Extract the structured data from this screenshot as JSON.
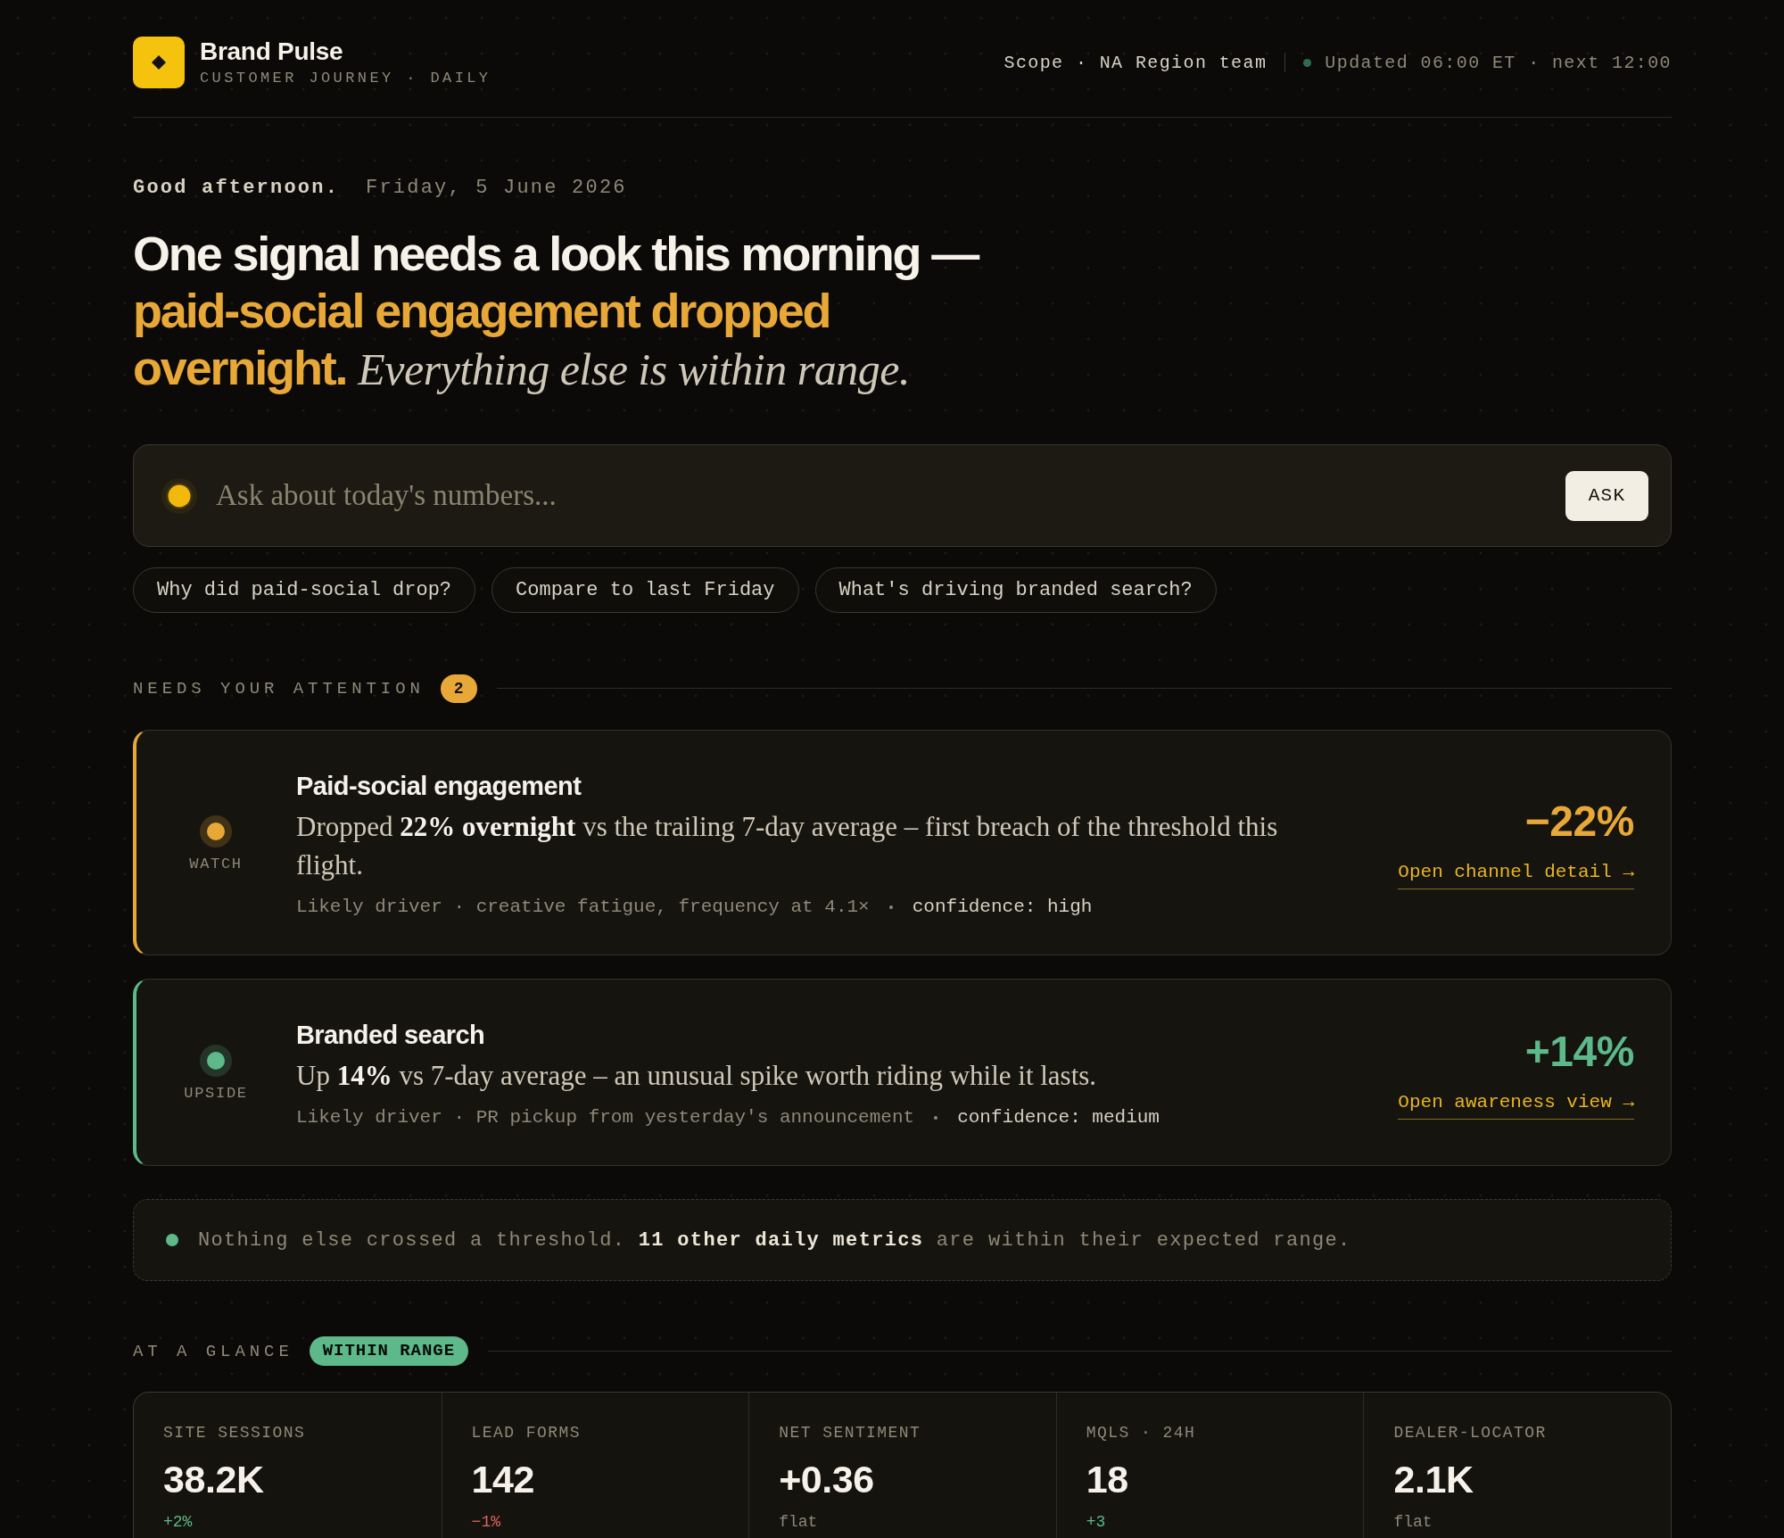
{
  "header": {
    "brand": "Brand Pulse",
    "subtitle": "CUSTOMER JOURNEY · DAILY",
    "scope": "Scope · NA Region team",
    "updated": "Updated 06:00 ET · next 12:00"
  },
  "greeting": {
    "salutation": "Good afternoon.",
    "date": "Friday, 5 June 2026"
  },
  "headline": {
    "lead": "One signal needs a look this morning —",
    "highlight": "paid-social engagement dropped overnight.",
    "tail": "Everything else is within range."
  },
  "ask": {
    "placeholder": "Ask about today's numbers...",
    "button": "ASK"
  },
  "suggestions": [
    "Why did paid-social drop?",
    "Compare to last Friday",
    "What's driving branded search?"
  ],
  "attention": {
    "title": "NEEDS YOUR ATTENTION",
    "count": "2",
    "cards": [
      {
        "status": "WATCH",
        "color": "#e8a838",
        "title": "Paid-social engagement",
        "body": "Dropped **22% overnight** vs the trailing 7-day average – first breach of the threshold this flight.",
        "driver": "Likely driver · creative fatigue, frequency at 4.1×",
        "confidence": "confidence: high",
        "change": "−22%",
        "link": "Open channel detail →"
      },
      {
        "status": "UPSIDE",
        "color": "#5db88a",
        "title": "Branded search",
        "body": "Up **14%** vs 7-day average – an unusual spike worth riding while it lasts.",
        "driver": "Likely driver · PR pickup from yesterday's announcement",
        "confidence": "confidence: medium",
        "change": "+14%",
        "link": "Open awareness view →"
      }
    ]
  },
  "note": "Nothing else crossed a threshold. **11 other daily metrics** are within their expected range.",
  "glance": {
    "title": "AT A GLANCE",
    "badge": "WITHIN RANGE",
    "metrics": [
      {
        "label": "SITE SESSIONS",
        "value": "38.2K",
        "delta": "+2%",
        "color": "#5db88a"
      },
      {
        "label": "LEAD FORMS",
        "value": "142",
        "delta": "−1%",
        "color": "#e0645c"
      },
      {
        "label": "NET SENTIMENT",
        "value": "+0.36",
        "delta": "flat",
        "color": "#8e8878"
      },
      {
        "label": "MQLS · 24H",
        "value": "18",
        "delta": "+3",
        "color": "#5db88a"
      },
      {
        "label": "DEALER-LOCATOR",
        "value": "2.1K",
        "delta": "flat",
        "color": "#8e8878"
      }
    ]
  }
}
